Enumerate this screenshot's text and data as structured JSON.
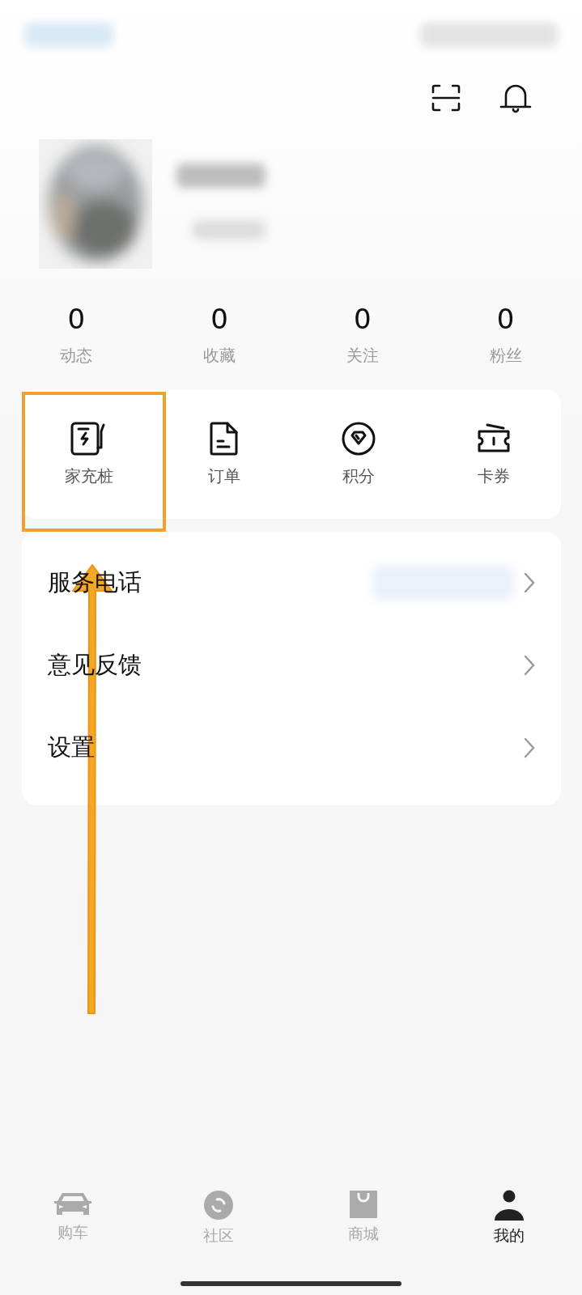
{
  "stats": [
    {
      "value": "0",
      "label": "动态"
    },
    {
      "value": "0",
      "label": "收藏"
    },
    {
      "value": "0",
      "label": "关注"
    },
    {
      "value": "0",
      "label": "粉丝"
    }
  ],
  "shortcuts": [
    {
      "kind": "charger",
      "label": "家充桩",
      "highlighted": true
    },
    {
      "kind": "order",
      "label": "订单",
      "highlighted": false
    },
    {
      "kind": "points",
      "label": "积分",
      "highlighted": false
    },
    {
      "kind": "coupon",
      "label": "卡券",
      "highlighted": false
    }
  ],
  "menu": [
    {
      "label": "服务电话",
      "blurred_value": true
    },
    {
      "label": "意见反馈",
      "blurred_value": false
    },
    {
      "label": "设置",
      "blurred_value": false
    }
  ],
  "nav": [
    {
      "kind": "car",
      "label": "购车",
      "selected": false
    },
    {
      "kind": "community",
      "label": "社区",
      "selected": false
    },
    {
      "kind": "shop",
      "label": "商城",
      "selected": false
    },
    {
      "kind": "profile",
      "label": "我的",
      "selected": true
    }
  ]
}
